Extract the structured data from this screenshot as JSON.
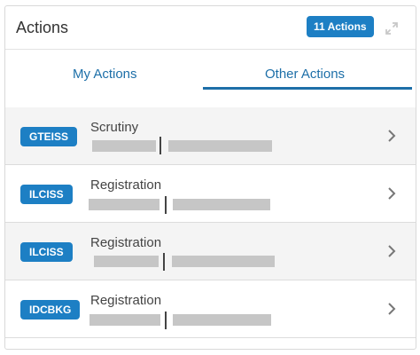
{
  "header": {
    "title": "Actions",
    "badge": "11 Actions",
    "expand_icon": "expand-icon"
  },
  "tabs": [
    {
      "label": "My Actions",
      "active": false
    },
    {
      "label": "Other Actions",
      "active": true
    }
  ],
  "colors": {
    "badge_blue": "#1d7fc4",
    "tab_blue": "#1d6fa8",
    "row_shade": "#f4f4f4",
    "redaction": "#c6c6c6"
  },
  "rows": [
    {
      "code": "GTEISS",
      "title": "Scrutiny",
      "chevron_icon": "chevron-right-icon"
    },
    {
      "code": "ILCISS",
      "title": "Registration",
      "chevron_icon": "chevron-right-icon"
    },
    {
      "code": "ILCISS",
      "title": "Registration",
      "chevron_icon": "chevron-right-icon"
    },
    {
      "code": "IDCBKG",
      "title": "Registration",
      "chevron_icon": "chevron-right-icon"
    }
  ]
}
